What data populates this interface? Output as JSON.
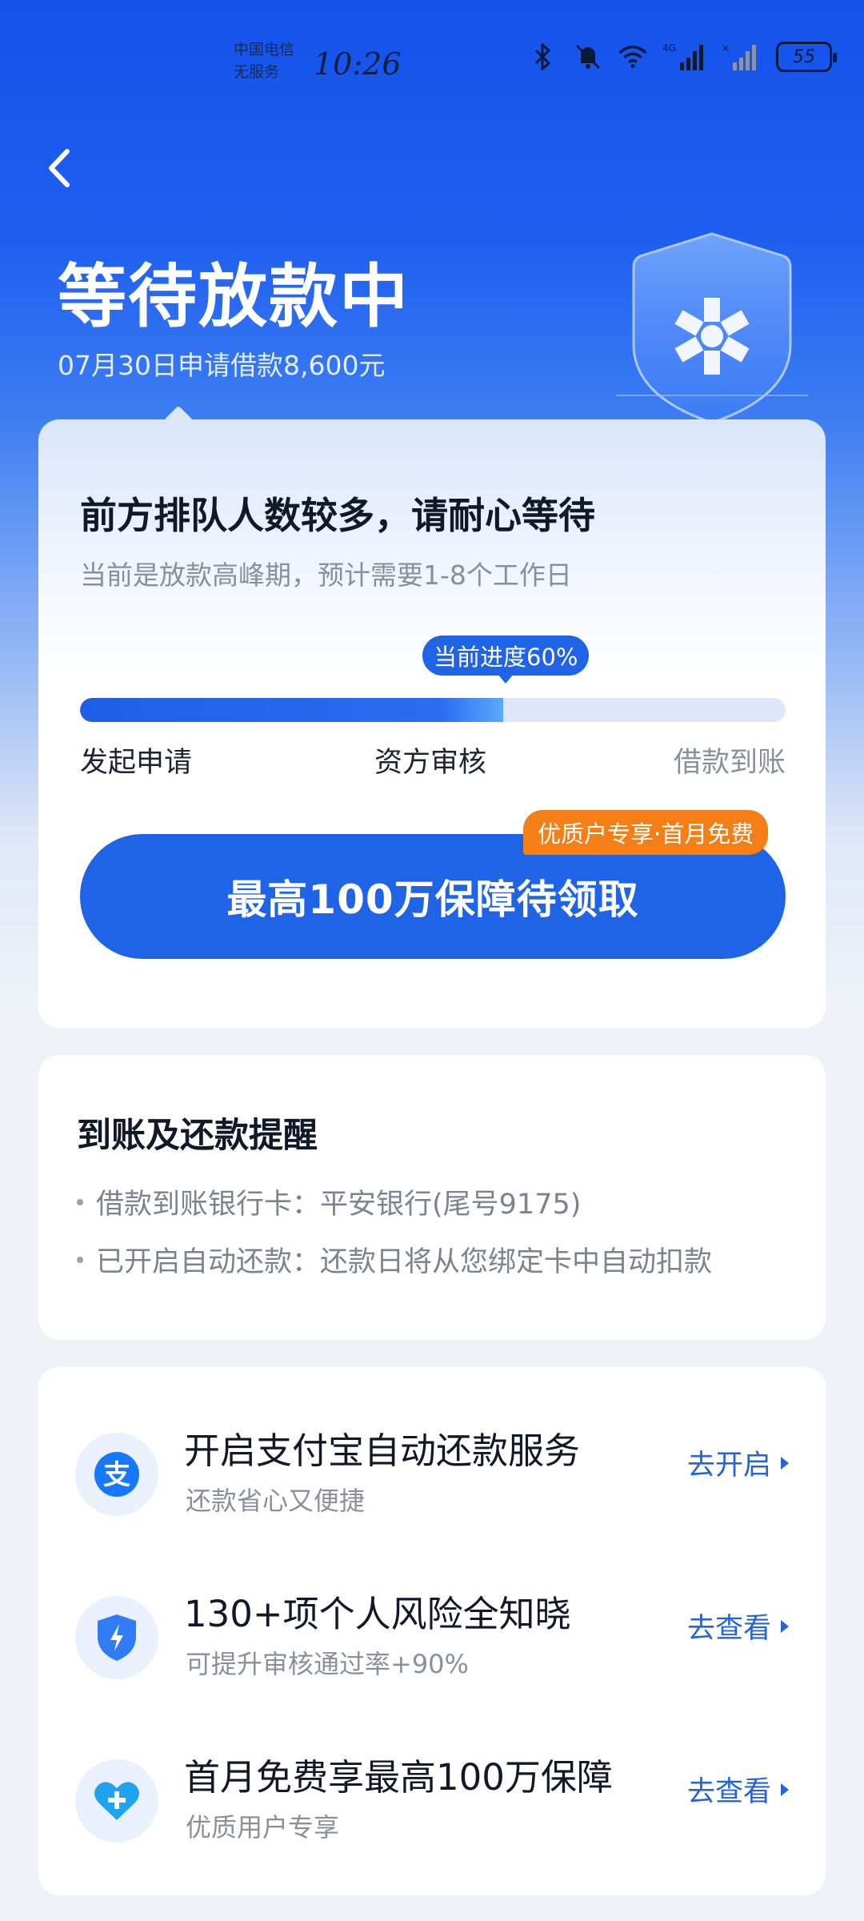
{
  "status_bar": {
    "carrier_line1": "中国电信",
    "carrier_line2": "无服务",
    "time": "10:26",
    "network": "4G",
    "battery": "55",
    "icons": [
      "bluetooth-icon",
      "mute-icon",
      "wifi-icon",
      "signal-4g-icon",
      "signal-empty-icon",
      "battery-icon"
    ]
  },
  "header": {
    "back_icon": "chevron-left-icon",
    "title": "等待放款中",
    "subtitle": "07月30日申请借款8,600元"
  },
  "progress_card": {
    "title": "前方排队人数较多，请耐心等待",
    "subtitle": "当前是放款高峰期，预计需要1-8个工作日",
    "badge": "当前进度60%",
    "progress": 0.6,
    "steps": [
      "发起申请",
      "资方审核",
      "借款到账"
    ],
    "cta_label": "最高100万保障待领取",
    "cta_tag": "优质户专享·首月免费",
    "accent_color": "#1f63e6",
    "tag_color": "#f57f17"
  },
  "reminder_card": {
    "title": "到账及还款提醒",
    "items": [
      "借款到账银行卡：平安银行(尾号9175)",
      "已开启自动还款：还款日将从您绑定卡中自动扣款"
    ]
  },
  "services": [
    {
      "icon": "alipay-icon",
      "title": "开启支付宝自动还款服务",
      "subtitle": "还款省心又便捷",
      "action": "去开启"
    },
    {
      "icon": "shield-lightning-icon",
      "title": "130+项个人风险全知晓",
      "subtitle": "可提升审核通过率+90%",
      "action": "去查看"
    },
    {
      "icon": "heart-plus-icon",
      "title": "首月免费享最高100万保障",
      "subtitle": "优质用户专享",
      "action": "去查看"
    }
  ]
}
